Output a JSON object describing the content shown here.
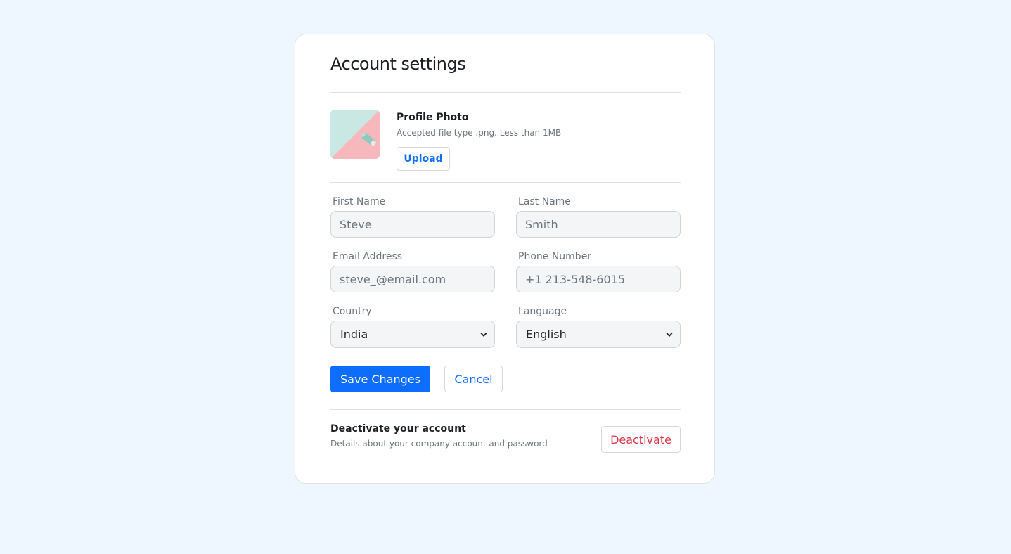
{
  "page": {
    "title": "Account settings"
  },
  "profile_photo": {
    "title": "Profile Photo",
    "hint": "Accepted file type .png. Less than 1MB",
    "upload_label": "Upload"
  },
  "form": {
    "first_name": {
      "label": "First Name",
      "placeholder": "Steve",
      "value": ""
    },
    "last_name": {
      "label": "Last Name",
      "placeholder": "Smith",
      "value": ""
    },
    "email": {
      "label": "Email Address",
      "placeholder": "steve_@email.com",
      "value": ""
    },
    "phone": {
      "label": "Phone Number",
      "placeholder": "+1 213-548-6015",
      "value": ""
    },
    "country": {
      "label": "Country",
      "selected": "India"
    },
    "language": {
      "label": "Language",
      "selected": "English"
    }
  },
  "actions": {
    "save_label": "Save Changes",
    "cancel_label": "Cancel"
  },
  "deactivate": {
    "title": "Deactivate your account",
    "description": "Details about your company account and password",
    "button_label": "Deactivate"
  },
  "colors": {
    "page_background": "#eef6ff",
    "primary": "#0d6efd",
    "danger": "#dc3545",
    "muted_text": "#6c757d",
    "input_background": "#f4f5f7"
  },
  "icons": {
    "select_arrow": "chevron-down-icon"
  }
}
